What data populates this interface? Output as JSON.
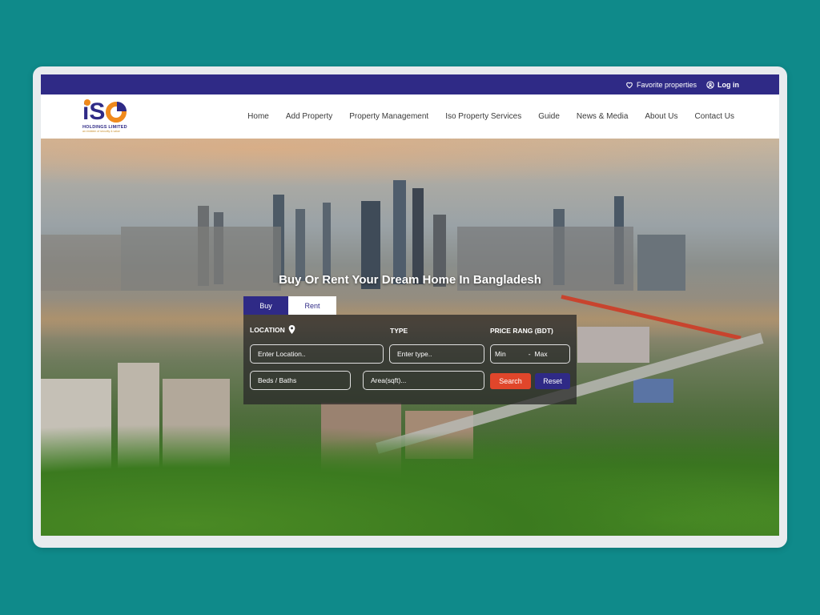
{
  "topbar": {
    "favorites_label": "Favorite properties",
    "login_label": "Log in"
  },
  "logo": {
    "text": "iSO",
    "subtitle": "HOLDINGS LIMITED",
    "tagline": "an emblem of security & value"
  },
  "nav": {
    "items": [
      {
        "label": "Home"
      },
      {
        "label": "Add Property"
      },
      {
        "label": "Property Management"
      },
      {
        "label": "Iso Property Services"
      },
      {
        "label": "Guide"
      },
      {
        "label": "News & Media"
      },
      {
        "label": "About Us"
      },
      {
        "label": "Contact Us"
      }
    ]
  },
  "hero": {
    "title": "Buy Or Rent Your Dream Home In Bangladesh"
  },
  "search": {
    "tabs": [
      {
        "label": "Buy",
        "active": true
      },
      {
        "label": "Rent",
        "active": false
      }
    ],
    "location_label": "LOCATION",
    "type_label": "TYPE",
    "price_label": "PRICE RANG (BDT)",
    "location_placeholder": "Enter Location..",
    "type_placeholder": "Enter type..",
    "price_min": "Min",
    "price_separator": "-",
    "price_max": "Max",
    "beds_placeholder": "Beds / Baths",
    "area_placeholder": "Area(sqft)...",
    "search_button": "Search",
    "reset_button": "Reset"
  },
  "colors": {
    "background": "#0f8a8a",
    "brand_primary": "#2f2a86",
    "brand_accent": "#f08a1c",
    "search_button": "#e0462b"
  },
  "icons": {
    "favorites": "heart-icon",
    "login": "user-circle-icon",
    "location": "map-pin-icon"
  }
}
